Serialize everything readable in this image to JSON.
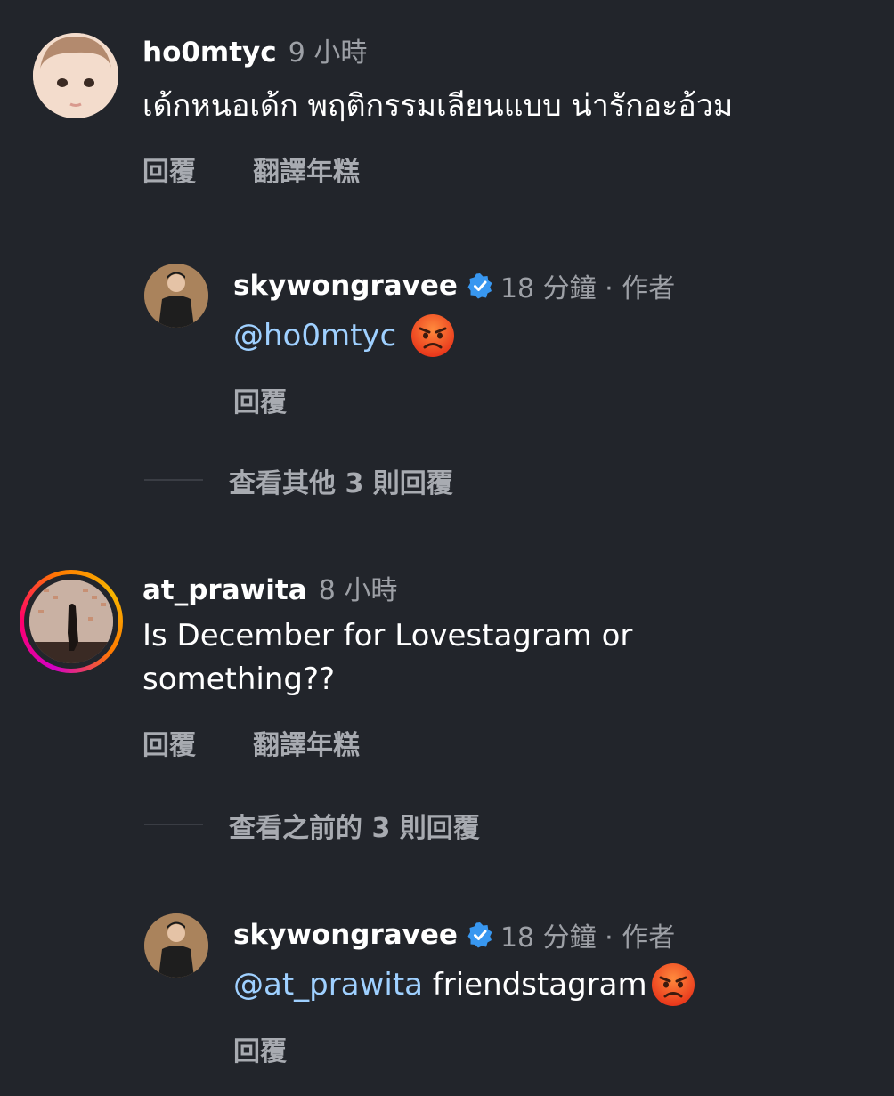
{
  "comments": [
    {
      "username": "ho0mtyc",
      "time": "9 小時",
      "text": "เด้กหนอเด้ก พฤติกรรมเลียนแบบ น่ารักอะอ้วม",
      "reply_label": "回覆",
      "translate_label": "翻譯年糕"
    },
    {
      "username": "at_prawita",
      "time": "8 小時",
      "text_line1": "Is December for Lovestagram or",
      "text_line2": "something??",
      "reply_label": "回覆",
      "translate_label": "翻譯年糕"
    }
  ],
  "replies": [
    {
      "username": "skywongravee",
      "time": "18 分鐘 · 作者",
      "mention": "@ho0mtyc",
      "text": "",
      "reply_label": "回覆"
    },
    {
      "username": "skywongravee",
      "time": "18 分鐘 · 作者",
      "mention": "@at_prawita",
      "text": " friendstagram",
      "reply_label": "回覆"
    }
  ],
  "view_more": {
    "other_replies": "查看其他 3 則回覆",
    "previous_replies": "查看之前的 3 則回覆"
  },
  "icons": {
    "verified": "verified-badge-icon",
    "angry_emoji": "angry-face-emoji"
  },
  "colors": {
    "background": "#22252b",
    "mention": "#9fd0ff",
    "verified": "#3897f0",
    "story_ring_start": "#f7b500",
    "story_ring_end": "#d300c5"
  }
}
